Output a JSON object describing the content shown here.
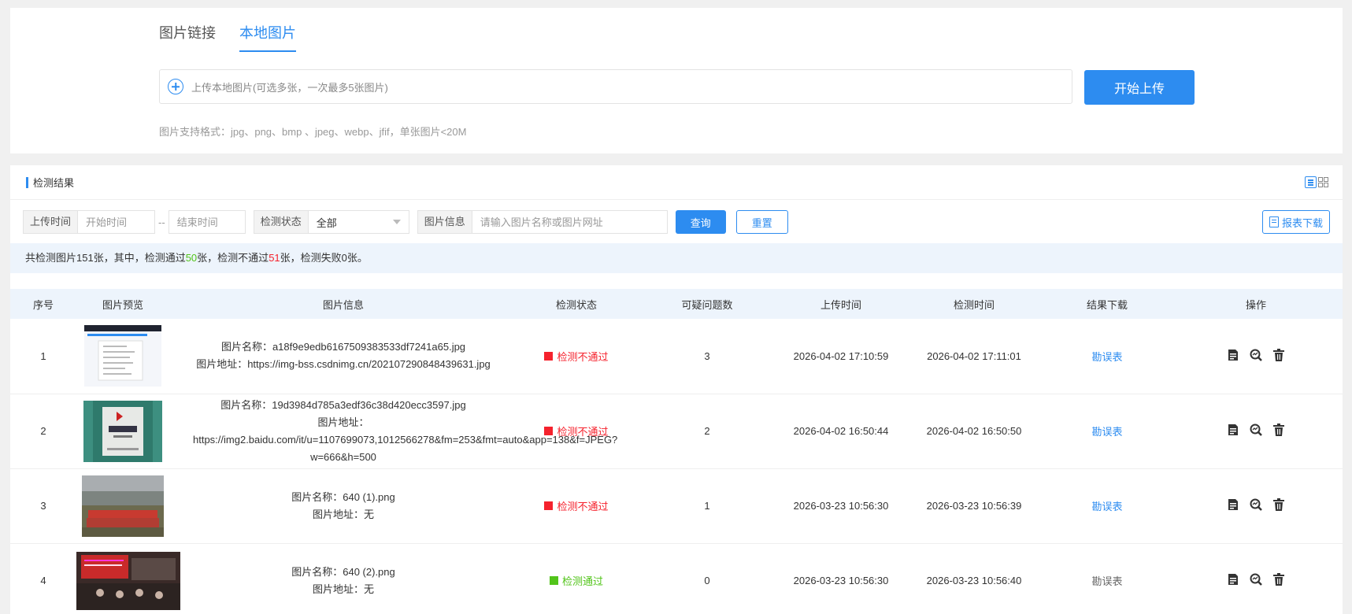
{
  "upload": {
    "tabs": [
      "图片链接",
      "本地图片"
    ],
    "active_tab": 1,
    "placeholder": "上传本地图片(可选多张，一次最多5张图片)",
    "start_button": "开始上传",
    "hint": "图片支持格式：jpg、png、bmp 、jpeg、webp、jfif，单张图片<20M"
  },
  "result": {
    "title": "检测结果",
    "filters": {
      "upload_time_label": "上传时间",
      "start_placeholder": "开始时间",
      "separator": "--",
      "end_placeholder": "结束时间",
      "status_label": "检测状态",
      "status_value": "全部",
      "info_label": "图片信息",
      "info_placeholder": "请输入图片名称或图片网址",
      "query_button": "查询",
      "reset_button": "重置",
      "download_button": "报表下载"
    },
    "summary": {
      "prefix": "共检测图片151张，其中，检测通过",
      "passed": "50",
      "mid": "张，检测不通过",
      "failed": "51",
      "suffix": "张，检测失败0张。"
    },
    "columns": [
      "序号",
      "图片预览",
      "图片信息",
      "检测状态",
      "可疑问题数",
      "上传时间",
      "检测时间",
      "结果下载",
      "操作"
    ],
    "rows": [
      {
        "index": "1",
        "name": "图片名称：a18f9e9edb6167509383533df7241a65.jpg",
        "url": "图片地址：https://img-bss.csdnimg.cn/202107290848439631.jpg",
        "status": "检测不通过",
        "status_type": "fail",
        "issues": "3",
        "upload_time": "2026-04-02 17:10:59",
        "check_time": "2026-04-02 17:11:01",
        "download": "勘误表",
        "download_enabled": true
      },
      {
        "index": "2",
        "name": "图片名称：19d3984d785a3edf36c38d420ecc3597.jpg",
        "url": "图片地址：https://img2.baidu.com/it/u=1107699073,1012566278&fm=253&fmt=auto&app=138&f=JPEG?w=666&h=500",
        "status": "检测不通过",
        "status_type": "fail",
        "issues": "2",
        "upload_time": "2026-04-02 16:50:44",
        "check_time": "2026-04-02 16:50:50",
        "download": "勘误表",
        "download_enabled": true
      },
      {
        "index": "3",
        "name": "图片名称：640 (1).png",
        "url": "图片地址：无",
        "status": "检测不通过",
        "status_type": "fail",
        "issues": "1",
        "upload_time": "2026-03-23 10:56:30",
        "check_time": "2026-03-23 10:56:39",
        "download": "勘误表",
        "download_enabled": true
      },
      {
        "index": "4",
        "name": "图片名称：640 (2).png",
        "url": "图片地址：无",
        "status": "检测通过",
        "status_type": "pass",
        "issues": "0",
        "upload_time": "2026-03-23 10:56:30",
        "check_time": "2026-03-23 10:56:40",
        "download": "勘误表",
        "download_enabled": false
      }
    ]
  },
  "colors": {
    "accent": "#2d8cf0",
    "fail": "#f5222d",
    "pass": "#52c41a"
  }
}
